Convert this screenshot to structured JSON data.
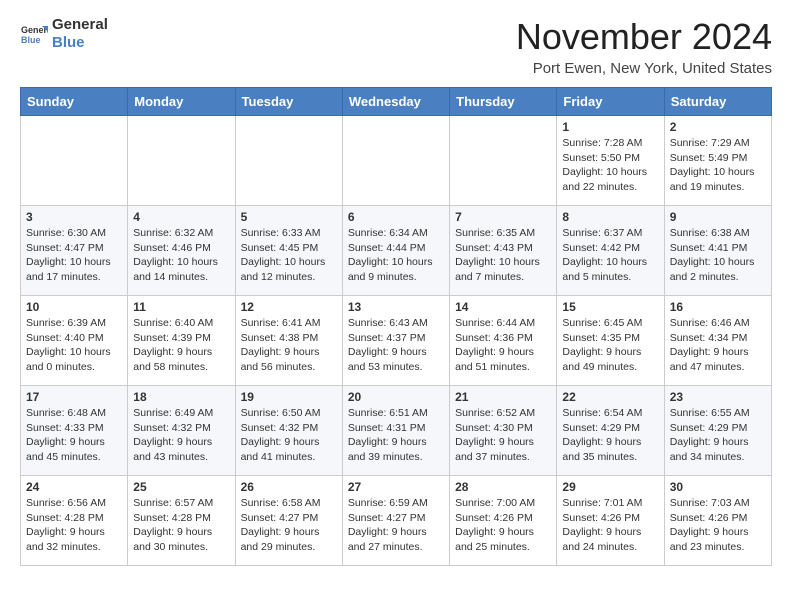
{
  "header": {
    "logo_line1": "General",
    "logo_line2": "Blue",
    "month_title": "November 2024",
    "location": "Port Ewen, New York, United States"
  },
  "weekdays": [
    "Sunday",
    "Monday",
    "Tuesday",
    "Wednesday",
    "Thursday",
    "Friday",
    "Saturday"
  ],
  "weeks": [
    [
      {
        "day": "",
        "info": ""
      },
      {
        "day": "",
        "info": ""
      },
      {
        "day": "",
        "info": ""
      },
      {
        "day": "",
        "info": ""
      },
      {
        "day": "",
        "info": ""
      },
      {
        "day": "1",
        "info": "Sunrise: 7:28 AM\nSunset: 5:50 PM\nDaylight: 10 hours and 22 minutes."
      },
      {
        "day": "2",
        "info": "Sunrise: 7:29 AM\nSunset: 5:49 PM\nDaylight: 10 hours and 19 minutes."
      }
    ],
    [
      {
        "day": "3",
        "info": "Sunrise: 6:30 AM\nSunset: 4:47 PM\nDaylight: 10 hours and 17 minutes."
      },
      {
        "day": "4",
        "info": "Sunrise: 6:32 AM\nSunset: 4:46 PM\nDaylight: 10 hours and 14 minutes."
      },
      {
        "day": "5",
        "info": "Sunrise: 6:33 AM\nSunset: 4:45 PM\nDaylight: 10 hours and 12 minutes."
      },
      {
        "day": "6",
        "info": "Sunrise: 6:34 AM\nSunset: 4:44 PM\nDaylight: 10 hours and 9 minutes."
      },
      {
        "day": "7",
        "info": "Sunrise: 6:35 AM\nSunset: 4:43 PM\nDaylight: 10 hours and 7 minutes."
      },
      {
        "day": "8",
        "info": "Sunrise: 6:37 AM\nSunset: 4:42 PM\nDaylight: 10 hours and 5 minutes."
      },
      {
        "day": "9",
        "info": "Sunrise: 6:38 AM\nSunset: 4:41 PM\nDaylight: 10 hours and 2 minutes."
      }
    ],
    [
      {
        "day": "10",
        "info": "Sunrise: 6:39 AM\nSunset: 4:40 PM\nDaylight: 10 hours and 0 minutes."
      },
      {
        "day": "11",
        "info": "Sunrise: 6:40 AM\nSunset: 4:39 PM\nDaylight: 9 hours and 58 minutes."
      },
      {
        "day": "12",
        "info": "Sunrise: 6:41 AM\nSunset: 4:38 PM\nDaylight: 9 hours and 56 minutes."
      },
      {
        "day": "13",
        "info": "Sunrise: 6:43 AM\nSunset: 4:37 PM\nDaylight: 9 hours and 53 minutes."
      },
      {
        "day": "14",
        "info": "Sunrise: 6:44 AM\nSunset: 4:36 PM\nDaylight: 9 hours and 51 minutes."
      },
      {
        "day": "15",
        "info": "Sunrise: 6:45 AM\nSunset: 4:35 PM\nDaylight: 9 hours and 49 minutes."
      },
      {
        "day": "16",
        "info": "Sunrise: 6:46 AM\nSunset: 4:34 PM\nDaylight: 9 hours and 47 minutes."
      }
    ],
    [
      {
        "day": "17",
        "info": "Sunrise: 6:48 AM\nSunset: 4:33 PM\nDaylight: 9 hours and 45 minutes."
      },
      {
        "day": "18",
        "info": "Sunrise: 6:49 AM\nSunset: 4:32 PM\nDaylight: 9 hours and 43 minutes."
      },
      {
        "day": "19",
        "info": "Sunrise: 6:50 AM\nSunset: 4:32 PM\nDaylight: 9 hours and 41 minutes."
      },
      {
        "day": "20",
        "info": "Sunrise: 6:51 AM\nSunset: 4:31 PM\nDaylight: 9 hours and 39 minutes."
      },
      {
        "day": "21",
        "info": "Sunrise: 6:52 AM\nSunset: 4:30 PM\nDaylight: 9 hours and 37 minutes."
      },
      {
        "day": "22",
        "info": "Sunrise: 6:54 AM\nSunset: 4:29 PM\nDaylight: 9 hours and 35 minutes."
      },
      {
        "day": "23",
        "info": "Sunrise: 6:55 AM\nSunset: 4:29 PM\nDaylight: 9 hours and 34 minutes."
      }
    ],
    [
      {
        "day": "24",
        "info": "Sunrise: 6:56 AM\nSunset: 4:28 PM\nDaylight: 9 hours and 32 minutes."
      },
      {
        "day": "25",
        "info": "Sunrise: 6:57 AM\nSunset: 4:28 PM\nDaylight: 9 hours and 30 minutes."
      },
      {
        "day": "26",
        "info": "Sunrise: 6:58 AM\nSunset: 4:27 PM\nDaylight: 9 hours and 29 minutes."
      },
      {
        "day": "27",
        "info": "Sunrise: 6:59 AM\nSunset: 4:27 PM\nDaylight: 9 hours and 27 minutes."
      },
      {
        "day": "28",
        "info": "Sunrise: 7:00 AM\nSunset: 4:26 PM\nDaylight: 9 hours and 25 minutes."
      },
      {
        "day": "29",
        "info": "Sunrise: 7:01 AM\nSunset: 4:26 PM\nDaylight: 9 hours and 24 minutes."
      },
      {
        "day": "30",
        "info": "Sunrise: 7:03 AM\nSunset: 4:26 PM\nDaylight: 9 hours and 23 minutes."
      }
    ]
  ]
}
